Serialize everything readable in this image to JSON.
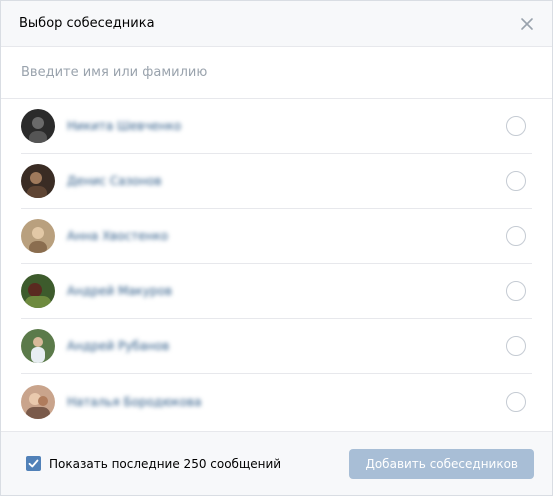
{
  "dialog": {
    "title": "Выбор собеседника",
    "close_icon": "close-icon"
  },
  "search": {
    "placeholder": "Введите имя или фамилию",
    "value": ""
  },
  "contacts": [
    {
      "name": "Никита Шевченко",
      "avatar_color": "#2b2b2b",
      "selected": false
    },
    {
      "name": "Денис Сазонов",
      "avatar_color": "#3a2c24",
      "selected": false
    },
    {
      "name": "Анна Хвостенко",
      "avatar_color": "#b9a07e",
      "selected": false
    },
    {
      "name": "Андрей Макуров",
      "avatar_color": "#3d5b2c",
      "selected": false
    },
    {
      "name": "Андрей Рубанов",
      "avatar_color": "#5b7a4a",
      "selected": false
    },
    {
      "name": "Наталья Бородюкова",
      "avatar_color": "#c9a48c",
      "selected": false
    }
  ],
  "footer": {
    "show_last_label": "Показать последние 250 сообщений",
    "show_last_checked": true,
    "add_button_label": "Добавить собеседников"
  },
  "colors": {
    "accent": "#5181b8",
    "button_disabled": "#a8bed6",
    "header_bg": "#f7f8fa"
  }
}
